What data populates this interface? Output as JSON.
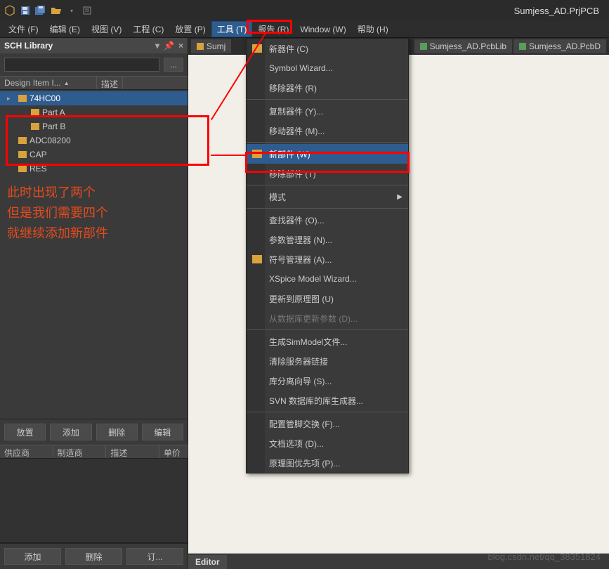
{
  "titlebar": {
    "title": "Sumjess_AD.PrjPCB"
  },
  "menubar": {
    "file": "文件 (F)",
    "edit": "编辑 (E)",
    "view": "视图 (V)",
    "project": "工程 (C)",
    "place": "放置 (P)",
    "tools": "工具 (T)",
    "report": "报告 (R)",
    "window": "Window (W)",
    "help": "帮助 (H)"
  },
  "sidebar": {
    "panel_title": "SCH Library",
    "pin_icon": "▾",
    "dock_icon": "⊟",
    "close_icon": "×",
    "search_placeholder": "",
    "more_btn": "...",
    "col_design": "Design Item I...",
    "col_desc": "描述",
    "tree": {
      "item0": "74HC00",
      "partA": "Part A",
      "partB": "Part B",
      "adc": "ADC08200",
      "cap": "CAP",
      "res": "RES"
    },
    "annotation_line1": "此时出现了两个",
    "annotation_line2": "但是我们需要四个",
    "annotation_line3": "就继续添加新部件",
    "btns1": {
      "place": "放置",
      "add": "添加",
      "delete": "删除",
      "edit": "编辑"
    },
    "grid": {
      "supplier": "供应商",
      "mfr": "制造商",
      "desc": "描述",
      "price": "单价"
    },
    "btns2": {
      "add": "添加",
      "delete": "删除",
      "order": "订..."
    }
  },
  "tabs": {
    "sch": "Sumj",
    "pcblib": "Sumjess_AD.PcbLib",
    "pcbdoc": "Sumjess_AD.PcbD"
  },
  "dropdown": {
    "new_comp": "新器件 (C)",
    "symbol_wizard": "Symbol Wizard...",
    "remove_comp": "移除器件 (R)",
    "copy_comp": "复制器件 (Y)...",
    "move_comp": "移动器件 (M)...",
    "new_part": "新部件 (W)",
    "remove_part": "移除部件 (T)",
    "mode": "模式",
    "find_comp": "查找器件 (O)...",
    "param_mgr": "参数管理器 (N)...",
    "symbol_mgr": "符号管理器 (A)...",
    "xspice": "XSpice Model Wizard...",
    "update_sch": "更新到原理图 (U)",
    "update_db": "从数据库更新参数 (D)...",
    "gen_sim": "生成SimModel文件...",
    "clear_server": "清除服务器链接",
    "lib_split": "库分离向导 (S)...",
    "svn_gen": "SVN 数据库的库生成器...",
    "pin_swap": "配置管脚交换 (F)...",
    "doc_opts": "文档选项 (D)...",
    "sch_prefs": "原理图优先项 (P)..."
  },
  "editor": {
    "label": "Editor"
  },
  "watermark": "blog.csdn.net/qq_38351824"
}
